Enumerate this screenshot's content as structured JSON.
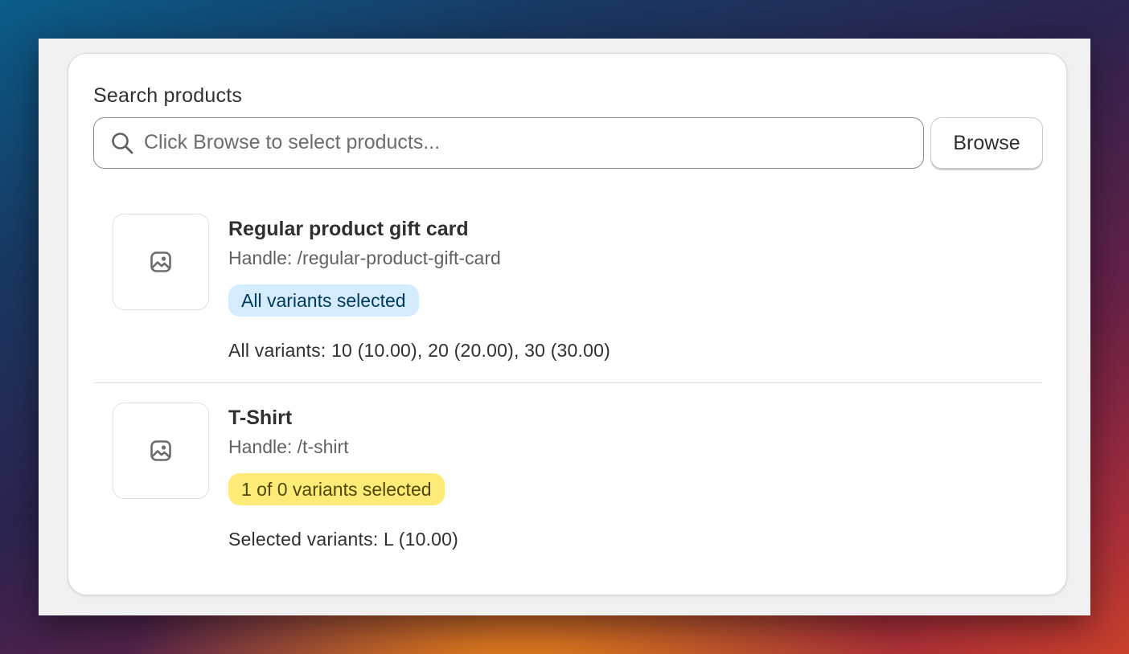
{
  "search": {
    "label": "Search products",
    "placeholder": "Click Browse to select products...",
    "value": "",
    "browse_label": "Browse"
  },
  "icons": {
    "search": "search-icon",
    "thumbnail": "image-placeholder-icon"
  },
  "colors": {
    "info_badge_bg": "#d5ebff",
    "info_badge_text": "#003a5a",
    "warning_badge_bg": "#ffeb78",
    "warning_badge_text": "#4f4700"
  },
  "products": [
    {
      "title": "Regular product gift card",
      "handle": "Handle: /regular-product-gift-card",
      "badge": "All variants selected",
      "variants": "All variants: 10 (10.00), 20 (20.00), 30 (30.00)"
    },
    {
      "title": "T-Shirt",
      "handle": "Handle: /t-shirt",
      "badge": "1 of 0 variants selected",
      "variants": "Selected variants: L (10.00)"
    }
  ]
}
